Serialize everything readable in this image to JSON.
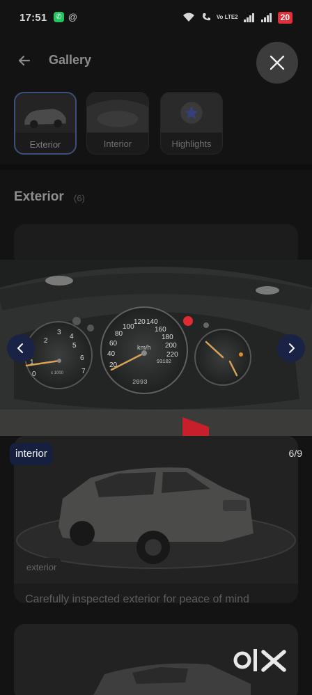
{
  "status_bar": {
    "time": "17:51",
    "network_label": "Vo LTE2",
    "battery": "20"
  },
  "header": {
    "title": "Gallery",
    "back_icon": "arrow-left-icon",
    "close_icon": "close-icon"
  },
  "tabs": [
    {
      "label": "Exterior",
      "active": true
    },
    {
      "label": "Interior",
      "active": false
    },
    {
      "label": "Highlights",
      "active": false
    }
  ],
  "section": {
    "title": "Exterior",
    "count": "(6)"
  },
  "viewer": {
    "badge": "interior",
    "counter": "6/9",
    "prev_icon": "chevron-left-icon",
    "next_icon": "chevron-right-icon",
    "speedometer": {
      "unit": "km/h",
      "ticks": [
        "20",
        "40",
        "60",
        "80",
        "100",
        "120",
        "140",
        "160",
        "180",
        "200",
        "220"
      ],
      "odometer": "93102"
    },
    "tachometer": {
      "ticks": [
        "0",
        "1",
        "2",
        "3",
        "4",
        "5",
        "6",
        "7"
      ],
      "unit": "x 1000"
    }
  },
  "card": {
    "tag": "exterior",
    "caption": "Carefully inspected exterior for peace of mind"
  },
  "brand": {
    "logo": "OLX"
  },
  "colors": {
    "accent_navy": "#16203e",
    "battery_red": "#e32f3a",
    "whatsapp_green": "#23c35f"
  }
}
